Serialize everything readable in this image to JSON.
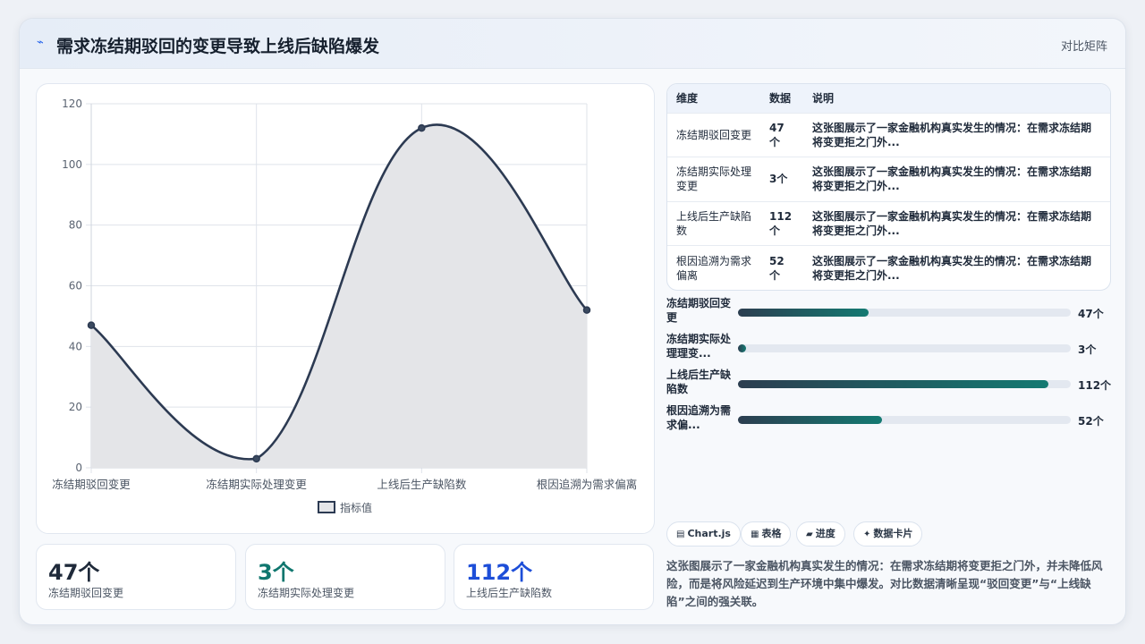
{
  "header": {
    "icon": "lightning-icon",
    "title": "需求冻结期驳回的变更导致上线后缺陷爆发",
    "link": "对比矩阵"
  },
  "chart_data": {
    "type": "line",
    "categories": [
      "冻结期驳回变更",
      "冻结期实际处理变更",
      "上线后生产缺陷数",
      "根因追溯为需求偏离"
    ],
    "series": [
      {
        "name": "指标值",
        "values": [
          47,
          3,
          112,
          52
        ]
      }
    ],
    "ylim": [
      0,
      120
    ],
    "yticks": [
      0,
      20,
      40,
      60,
      80,
      100,
      120
    ],
    "grid": true,
    "fill": true,
    "smooth": true,
    "legend": "bottom",
    "line_color": "#2c3a52",
    "fill_color": "#e4e5e8"
  },
  "stats": [
    {
      "value": "47个",
      "label": "冻结期驳回变更",
      "color": "#1f2a3a"
    },
    {
      "value": "3个",
      "label": "冻结期实际处理变更",
      "color": "#0f766e"
    },
    {
      "value": "112个",
      "label": "上线后生产缺陷数",
      "color": "#1d4ed8"
    }
  ],
  "table": {
    "headers": [
      "维度",
      "数据",
      "说明"
    ],
    "rows": [
      [
        "冻结期驳回变更",
        "47个",
        "这张图展示了一家金融机构真实发生的情况：在需求冻结期将变更拒之门外..."
      ],
      [
        "冻结期实际处理变更",
        "3个",
        "这张图展示了一家金融机构真实发生的情况：在需求冻结期将变更拒之门外..."
      ],
      [
        "上线后生产缺陷数",
        "112个",
        "这张图展示了一家金融机构真实发生的情况：在需求冻结期将变更拒之门外..."
      ],
      [
        "根因追溯为需求偏离",
        "52个",
        "这张图展示了一家金融机构真实发生的情况：在需求冻结期将变更拒之门外..."
      ]
    ]
  },
  "progress": [
    {
      "label": "冻结期驳回变更",
      "value": 47,
      "display": "47个"
    },
    {
      "label": "冻结期实际处理理变...",
      "value": 3,
      "display": "3个"
    },
    {
      "label": "上线后生产缺陷数",
      "value": 112,
      "display": "112个"
    },
    {
      "label": "根因追溯为需求偏...",
      "value": 52,
      "display": "52个"
    }
  ],
  "progress_max": 120,
  "chips": [
    {
      "icon": "chart-icon",
      "label": "Chart.js"
    },
    {
      "icon": "table-icon",
      "label": "表格"
    },
    {
      "icon": "progress-icon",
      "label": "进度"
    },
    {
      "icon": "sparkle-icon",
      "label": "数据卡片"
    }
  ],
  "summary": "这张图展示了一家金融机构真实发生的情况：在需求冻结期将变更拒之门外，并未降低风险，而是将风险延迟到生产环境中集中爆发。对比数据清晰呈现“驳回变更”与“上线缺陷”之间的强关联。"
}
